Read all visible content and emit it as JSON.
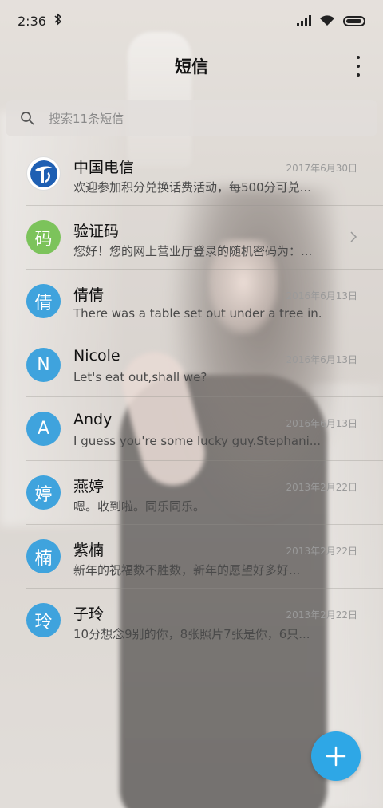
{
  "status_bar": {
    "time": "2:36",
    "bluetooth": "bluetooth-icon",
    "signal": "signal-icon",
    "wifi": "wifi-icon",
    "battery": "battery-icon",
    "battery_level": 0.95
  },
  "header": {
    "title": "短信",
    "menu_icon": "more-vertical-icon"
  },
  "search": {
    "icon": "search-icon",
    "placeholder": "搜索11条短信"
  },
  "conversations": [
    {
      "avatar": "中国电信 logo",
      "name": "中国电信",
      "preview": "欢迎参加积分兑换话费活动，每500分可兑...",
      "date": "2017年6月30日",
      "avatar_color": "#ffffff"
    },
    {
      "avatar": "码",
      "name": "验证码",
      "preview": "您好！您的网上营业厅登录的随机密码为：...",
      "date": "",
      "avatar_color": "#7cc35b",
      "chevron": "chevron-right-icon"
    },
    {
      "avatar": "倩",
      "name": "倩倩",
      "preview": "There was a table set out under a tree in...",
      "date": "2016年6月13日",
      "avatar_color": "#3fa3dd"
    },
    {
      "avatar": "N",
      "name": "Nicole",
      "preview": "Let's eat out,shall we?",
      "date": "2016年6月13日",
      "avatar_color": "#3fa3dd"
    },
    {
      "avatar": "A",
      "name": "Andy",
      "preview": "I guess you're some lucky guy.Stephani...",
      "date": "2016年6月13日",
      "avatar_color": "#3fa3dd"
    },
    {
      "avatar": "婷",
      "name": "燕婷",
      "preview": "嗯。收到啦。同乐同乐。",
      "date": "2013年2月22日",
      "avatar_color": "#3fa3dd"
    },
    {
      "avatar": "楠",
      "name": "紫楠",
      "preview": "新年的祝福数不胜数，新年的愿望好多好...",
      "date": "2013年2月22日",
      "avatar_color": "#3fa3dd"
    },
    {
      "avatar": "玲",
      "name": "子玲",
      "preview": "10分想念9别的你，8张照片7张是你，6只...",
      "date": "2013年2月22日",
      "avatar_color": "#3fa3dd"
    }
  ],
  "fab": {
    "icon": "plus-icon",
    "color": "#2ea7e6"
  }
}
